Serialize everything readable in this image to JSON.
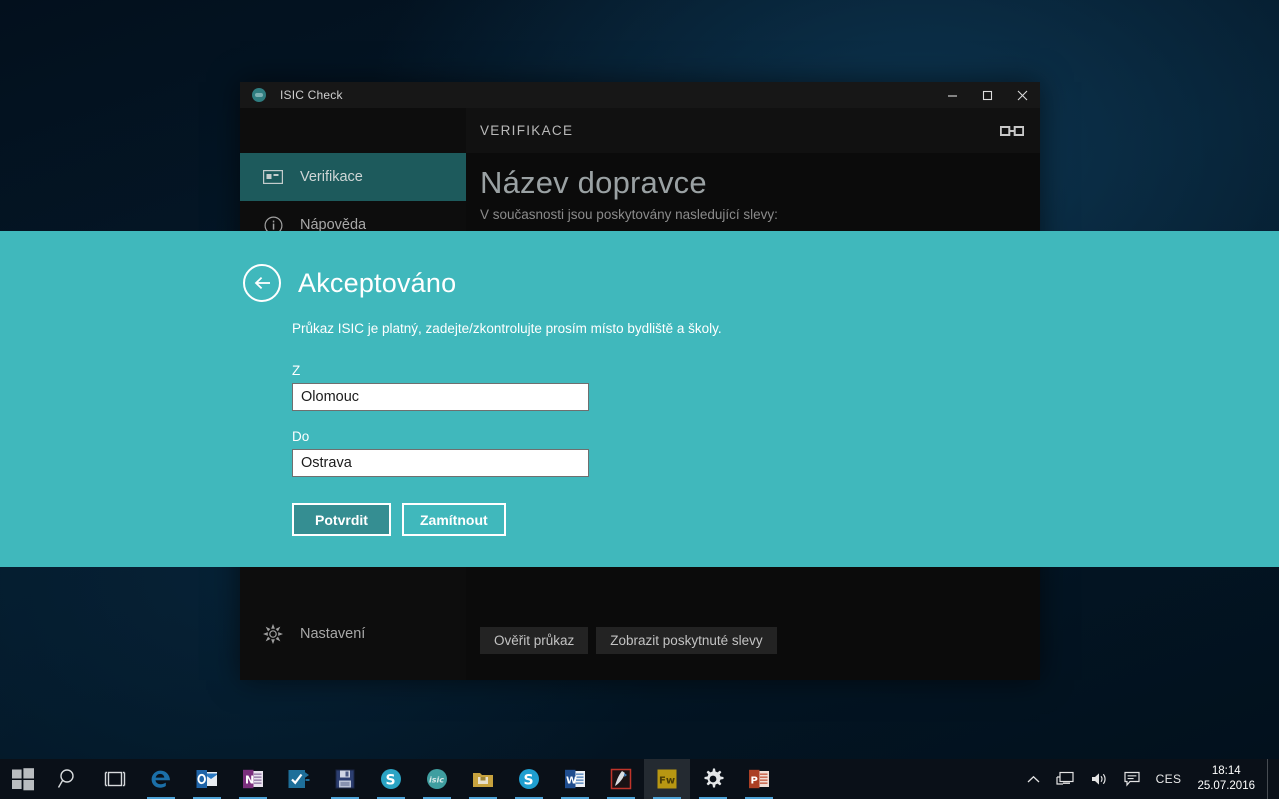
{
  "window": {
    "title": "ISIC Check",
    "logo_icon": "isic-logo-icon",
    "minimize_icon": "minimize-icon",
    "maximize_icon": "maximize-icon",
    "close_icon": "close-icon"
  },
  "sidebar": {
    "items": [
      {
        "label": "Verifikace",
        "icon": "id-card-icon",
        "active": true
      },
      {
        "label": "Nápověda",
        "icon": "info-circle-icon",
        "active": false
      }
    ],
    "settings": {
      "label": "Nastavení",
      "icon": "gear-icon"
    }
  },
  "content": {
    "header_title": "VERIFIKACE",
    "link_icon": "chain-link-icon",
    "carrier_name": "Název dopravce",
    "carrier_subtitle": "V současnosti jsou poskytovány nasledující slevy:",
    "actions": [
      {
        "label": "Ověřit průkaz"
      },
      {
        "label": "Zobrazit poskytnuté slevy"
      }
    ]
  },
  "overlay": {
    "back_icon": "back-arrow-icon",
    "title": "Akceptováno",
    "description": "Průkaz ISIC je platný, zadejte/zkontrolujte prosím místo bydliště a školy.",
    "fields": [
      {
        "label": "Z",
        "value": "Olomouc",
        "placeholder": ""
      },
      {
        "label": "Do",
        "value": "Ostrava",
        "placeholder": ""
      }
    ],
    "buttons": [
      {
        "label": "Potvrdit",
        "state": "pressed"
      },
      {
        "label": "Zamítnout",
        "state": "normal"
      }
    ],
    "accent_color": "#40b8bc",
    "pressed_color": "#358e92"
  },
  "taskbar": {
    "start_icon": "windows-start-icon",
    "search_icon": "search-icon",
    "taskview_icon": "task-view-icon",
    "apps": [
      {
        "icon": "edge-icon",
        "running": true,
        "active": false
      },
      {
        "icon": "outlook-icon",
        "running": true,
        "active": false
      },
      {
        "icon": "onenote-icon",
        "running": true,
        "active": false
      },
      {
        "icon": "wunderlist-icon",
        "running": false,
        "active": false
      },
      {
        "icon": "save-disk-icon",
        "running": true,
        "active": false
      },
      {
        "icon": "skype-business-icon",
        "running": true,
        "active": false
      },
      {
        "icon": "isic-icon",
        "running": true,
        "active": false
      },
      {
        "icon": "folder-icon",
        "running": true,
        "active": false
      },
      {
        "icon": "skype-icon",
        "running": true,
        "active": false
      },
      {
        "icon": "word-icon",
        "running": true,
        "active": false
      },
      {
        "icon": "acrobat-icon",
        "running": true,
        "active": false
      },
      {
        "icon": "fireworks-icon",
        "running": true,
        "active": true
      },
      {
        "icon": "settings-gear-icon",
        "running": true,
        "active": false
      },
      {
        "icon": "powerpoint-icon",
        "running": true,
        "active": false
      }
    ],
    "tray": {
      "chevron_up_icon": "show-hidden-icons-icon",
      "network_icon": "network-icon",
      "volume_icon": "volume-icon",
      "action_center_icon": "action-center-icon",
      "language": "CES",
      "time": "18:14",
      "date": "25.07.2016"
    }
  }
}
